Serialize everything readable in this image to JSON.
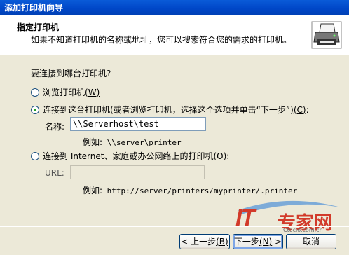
{
  "window": {
    "title": "添加打印机向导"
  },
  "header": {
    "title": "指定打印机",
    "subtitle": "如果不知道打印机的名称或地址，您可以搜索符合您的需求的打印机。",
    "icon": "printer-icon"
  },
  "prompt": "要连接到哪台打印机?",
  "options": {
    "browse": {
      "label": "浏览打印机",
      "key": "(W)",
      "selected": false
    },
    "connect": {
      "label": "连接到这台打印机(或者浏览打印机，选择这个选项并单击“下一步”)",
      "key": "(C)",
      "suffix": ":",
      "selected": true
    },
    "internet": {
      "label": "连接到 Internet、家庭或办公网络上的打印机",
      "key": "(O)",
      "suffix": ":",
      "selected": false
    }
  },
  "name_field": {
    "label": "名称:",
    "value": "\\\\Serverhost\\test"
  },
  "example_name": {
    "label": "例如:",
    "value": "\\\\server\\printer"
  },
  "url_field": {
    "label": "URL:",
    "value": ""
  },
  "example_url": {
    "label": "例如:",
    "value": "http://server/printers/myprinter/.printer"
  },
  "buttons": {
    "back": {
      "label": "< 上一步",
      "key": "(B)"
    },
    "next": {
      "label": "下一步",
      "key": "(N)",
      "suffix": " >"
    },
    "cancel": "取消"
  },
  "watermark": {
    "brand_latin": "IT",
    "brand_cn": "专家网",
    "domain": "Ctocio.com.cn"
  }
}
